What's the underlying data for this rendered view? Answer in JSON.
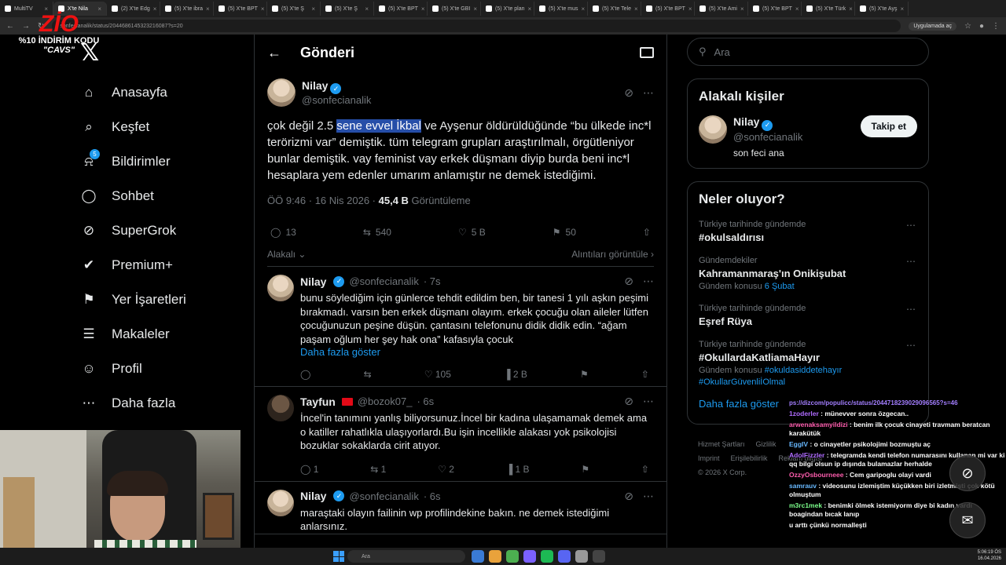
{
  "browser": {
    "tabs": [
      "MultiTV",
      "X'te Nila",
      "(2) X'te Edg",
      "(5) X'te ibra",
      "(5) X'te BPT",
      "(5) X'te Ş",
      "(5) X'te Ş",
      "(5) X'te BPT",
      "(5) X'te GBI",
      "(5) X'te plan",
      "(5) X'te mus",
      "(5) X'te Tele",
      "(5) X'te BPT",
      "(5) X'te Ami",
      "(5) X'te BPT",
      "(5) X'te Türk",
      "(5) X'te Ayş"
    ],
    "url": "sonfecianalik/status/2044686145323216087?s=20",
    "app_button": "Uygulamada aç"
  },
  "promo": {
    "brand": "ZİO",
    "line1": "%10 İNDİRİM KODU",
    "line2": "\"CAVS\""
  },
  "sidebar": {
    "logo": "𝕏",
    "items": [
      {
        "label": "Anasayfa",
        "icon": "home-icon",
        "glyph": "⌂"
      },
      {
        "label": "Keşfet",
        "icon": "search-icon",
        "glyph": "⌕"
      },
      {
        "label": "Bildirimler",
        "icon": "bell-icon",
        "glyph": "⍾",
        "badge": "5"
      },
      {
        "label": "Sohbet",
        "icon": "chat-icon",
        "glyph": "◯"
      },
      {
        "label": "SuperGrok",
        "icon": "grok-icon",
        "glyph": "⊘"
      },
      {
        "label": "Premium+",
        "icon": "premium-icon",
        "glyph": "✔"
      },
      {
        "label": "Yer İşaretleri",
        "icon": "bookmark-icon",
        "glyph": "⚑"
      },
      {
        "label": "Makaleler",
        "icon": "article-icon",
        "glyph": "☰"
      },
      {
        "label": "Profil",
        "icon": "profile-icon",
        "glyph": "☺"
      },
      {
        "label": "Daha fazla",
        "icon": "more-icon",
        "glyph": "⋯"
      }
    ]
  },
  "main": {
    "header_title": "Gönderi",
    "post": {
      "name": "Nilay",
      "handle": "@sonfecianalik",
      "text_before": "çok değil 2.5 ",
      "text_highlight": "sene evvel İkbal",
      "text_after": " ve Ayşenur öldürüldüğünde “bu ülkede inc*l terörizmi var” demiştik. tüm telegram grupları araştırılmalı, örgütleniyor bunlar demiştik. vay feminist vay erkek düşmanı diyip burda beni inc*l hesaplara yem edenler umarım anlamıştır ne demek istediğimi.",
      "time": "ÖÖ 9:46 · 16 Nis 2026 · ",
      "views": "45,4 B",
      "views_label": " Görüntüleme",
      "replies": "13",
      "reposts": "540",
      "likes": "5 B",
      "bookmarks": "50",
      "relevance": "Alakalı",
      "quotes_link": "Alıntıları görüntüle"
    },
    "replies": [
      {
        "name": "Nilay",
        "handle": "@sonfecianalik",
        "time": "· 7s",
        "text": "bunu söylediğim için günlerce tehdit edildim ben, bir tanesi 1 yılı aşkın peşimi bırakmadı. varsın ben erkek düşmanı olayım. erkek çocuğu olan aileler lütfen çocuğunuzun peşine düşün. çantasını telefonunu didik didik edin. “ağam paşam oğlum her şey hak ona” kafasıyla çocuk",
        "more": "Daha fazla göster",
        "replies": "",
        "reposts": "",
        "likes": "105",
        "views": "2 B"
      },
      {
        "name": "Tayfun",
        "handle": "@bozok07_",
        "time": "· 6s",
        "text": "İncel'in tanımını yanlış biliyorsunuz.İncel bir kadına ulaşamamak demek ama o katiller rahatlıkla ulaşıyorlardı.Bu işin incellikle alakası yok psikolojisi bozuklar sokaklarda cirit atıyor.",
        "replies": "1",
        "reposts": "1",
        "likes": "2",
        "views": "1 B"
      },
      {
        "name": "Nilay",
        "handle": "@sonfecianalik",
        "time": "· 6s",
        "text": "maraştaki olayın failinin wp profilindekine bakın. ne demek istediğimi anlarsınız."
      }
    ]
  },
  "right": {
    "search_placeholder": "Ara",
    "related_title": "Alakalı kişiler",
    "person": {
      "name": "Nilay",
      "handle": "@sonfecianalik",
      "bio": "son feci ana",
      "follow": "Takip et"
    },
    "trends_title": "Neler oluyor?",
    "trends": [
      {
        "cat": "Türkiye tarihinde gündemde",
        "title": "#okulsaldırısı"
      },
      {
        "cat": "Gündemdekiler",
        "title": "Kahramanmaraş'ın Onikişubat",
        "ctx": "Gündem konusu ",
        "ctx_link": "6 Şubat"
      },
      {
        "cat": "Türkiye tarihinde gündemde",
        "title": "Eşref Rüya"
      },
      {
        "cat": "Türkiye tarihinde gündemde",
        "title": "#OkullardaKatliamaHayır",
        "ctx": "Gündem konusu ",
        "ctx_link": "#okuldasiddetehayır",
        "ctx2": "#OkullarGüvenliİOlmal"
      }
    ],
    "show_more": "Daha fazla göster",
    "footer": [
      "Hizmet Şartları",
      "Gizlilik",
      "Imprint",
      "Erişilebilirlik",
      "Reklam bilgisi",
      "© 2026 X Corp."
    ]
  },
  "chat": [
    {
      "user": "",
      "text": "ps://dizcom/populicc/status/2044718239029096565?s=46",
      "cls": "url2"
    },
    {
      "user": "1zoderler",
      "text": " : münevver sonra özgecan..",
      "cls": "u"
    },
    {
      "user": "arwenaksamyildizi",
      "text": " : benim ilk çocuk cinayeti travmam beratcan karakütük",
      "cls": "u2"
    },
    {
      "user": "EggIV",
      "text": " : o cinayetler psikolojimi bozmuştu aç",
      "cls": "u3"
    },
    {
      "user": "AdolFizzler",
      "text": " : telegramda kendi telefon numarasını kullanan mi var ki qq bilgi olsun ip dışında bulamazlar herhalde",
      "cls": "u"
    },
    {
      "user": "OzzyOsbourneee",
      "text": " : Cem garipoglu olayi vardi",
      "cls": "u2"
    },
    {
      "user": "samrauv",
      "text": " : videosunu izlemiştim küçükken biri izletmişti çok kötü olmuştum",
      "cls": "u3"
    },
    {
      "user": "m3rc1mek",
      "text": " : benimki ölmek istemiyorm diye bi kadın vardı boagindan bıcak lanıp",
      "cls": "u4"
    },
    {
      "user": "",
      "text": "u arttı çünkü normalleşti",
      "cls": ""
    }
  ],
  "taskbar": {
    "search": "Ara",
    "clock": "5:06:19 ÖS",
    "date": "16.04.2026"
  }
}
